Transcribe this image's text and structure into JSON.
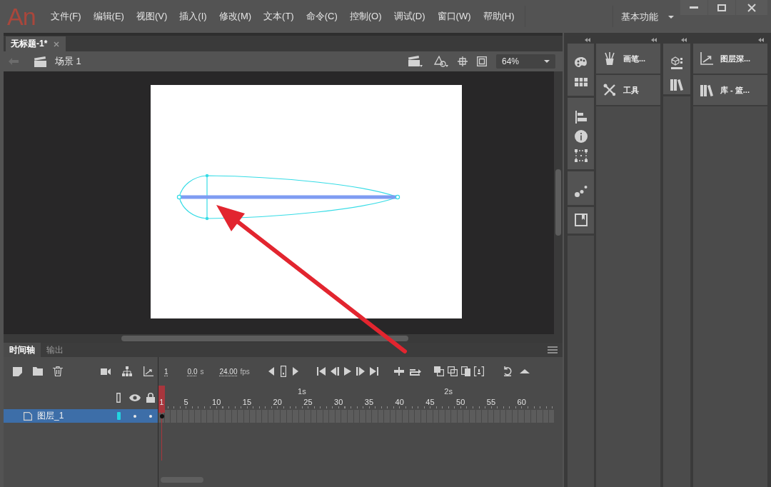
{
  "app_bar": {
    "logo": "An",
    "menu": [
      "文件(F)",
      "编辑(E)",
      "视图(V)",
      "插入(I)",
      "修改(M)",
      "文本(T)",
      "命令(C)",
      "控制(O)",
      "调试(D)",
      "窗口(W)",
      "帮助(H)"
    ],
    "workspace": "基本功能"
  },
  "document_tabs": [
    {
      "title": "无标题-1*",
      "selected": true
    }
  ],
  "edit_bar": {
    "scene": "场景 1",
    "zoom": "64%"
  },
  "panel_dock": {
    "columns": [
      {
        "buttons": [
          {
            "label": "画笔..."
          },
          {
            "label": "工具"
          }
        ]
      },
      {
        "buttons": [
          {
            "label": "图层深..."
          },
          {
            "label": "库 - 篮..."
          }
        ]
      }
    ]
  },
  "timeline": {
    "tabs": [
      {
        "label": "时间轴",
        "selected": true
      },
      {
        "label": "输出",
        "selected": false
      }
    ],
    "current_frame": "1",
    "time": "0.0",
    "time_unit": "s",
    "frame_rate": "24.00",
    "frame_rate_unit": "fps",
    "ruler": {
      "seconds": [
        "1s",
        "2s"
      ],
      "frames": [
        "1",
        "5",
        "10",
        "15",
        "20",
        "25",
        "30",
        "35",
        "40",
        "45",
        "50",
        "55",
        "60"
      ]
    },
    "layers": [
      {
        "name": "图层_1",
        "selected": true,
        "color": "#22d3e0"
      }
    ]
  }
}
